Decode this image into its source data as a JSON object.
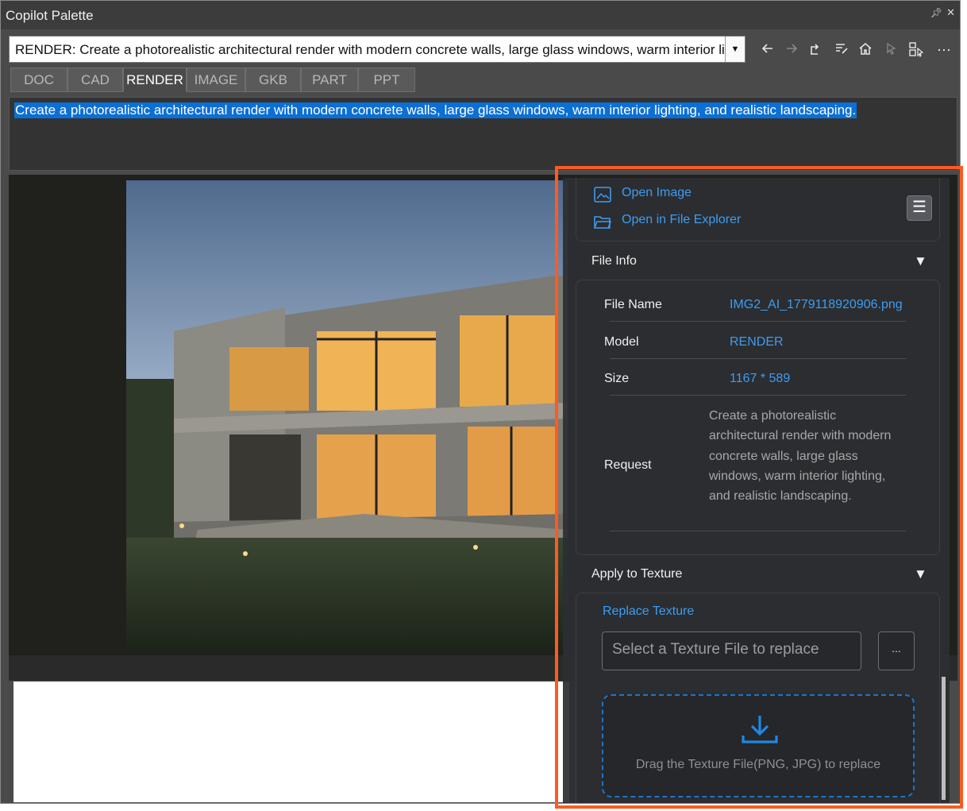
{
  "window": {
    "title": "Copilot Palette"
  },
  "toolbar": {
    "prompt_value": "RENDER: Create a photorealistic architectural render with modern concrete walls, large glass windows, warm interior lighting, and realistic landscaping.",
    "icons": [
      "back-arrow-icon",
      "forward-arrow-icon",
      "export-icon",
      "edit-list-icon",
      "home-icon",
      "select-icon",
      "layout-icon",
      "more-icon"
    ]
  },
  "tabs": [
    {
      "label": "DOC"
    },
    {
      "label": "CAD"
    },
    {
      "label": "RENDER"
    },
    {
      "label": "IMAGE"
    },
    {
      "label": "GKB"
    },
    {
      "label": "PART"
    },
    {
      "label": "PPT"
    }
  ],
  "prompt_area": {
    "text": "Create a photorealistic architectural render with modern concrete walls, large glass windows, warm interior lighting, and realistic landscaping."
  },
  "panel": {
    "open_image": "Open Image",
    "open_explorer": "Open in File Explorer",
    "file_info": {
      "header": "File Info",
      "rows": [
        {
          "label": "File Name",
          "value": "IMG2_AI_1779118920906.png"
        },
        {
          "label": "Model",
          "value": "RENDER"
        },
        {
          "label": "Size",
          "value": "1167 * 589"
        },
        {
          "label": "Request",
          "value": "Create a photorealistic architectural render with modern concrete walls, large glass windows, warm interior lighting, and realistic landscaping."
        }
      ]
    },
    "texture": {
      "header": "Apply to Texture",
      "replace_label": "Replace Texture",
      "input_placeholder": "Select a Texture File to replace",
      "browse_label": "...",
      "drop_text": "Drag the Texture File(PNG, JPG) to replace"
    }
  },
  "colors": {
    "accent": "#3d9df2",
    "highlight_box": "#ff5a1f",
    "selection": "#0b6fd6"
  }
}
